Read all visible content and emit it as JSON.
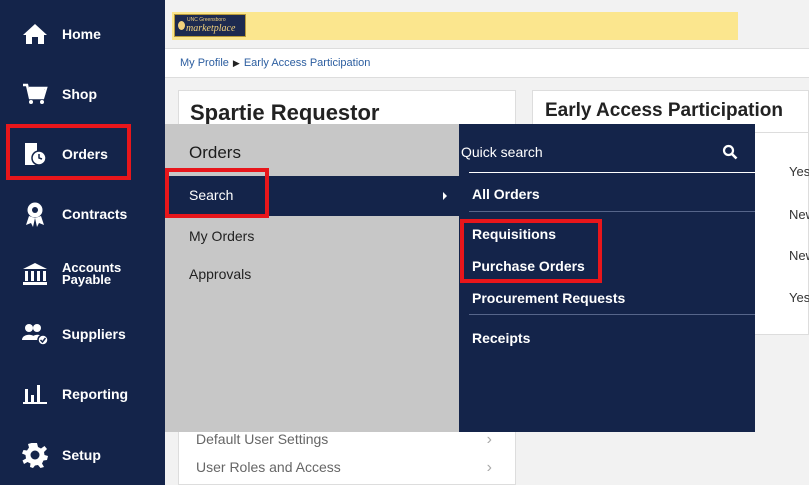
{
  "sidebar": {
    "items": [
      {
        "label": "Home",
        "icon": "home-icon"
      },
      {
        "label": "Shop",
        "icon": "cart-icon"
      },
      {
        "label": "Orders",
        "icon": "orders-icon"
      },
      {
        "label": "Contracts",
        "icon": "contracts-icon"
      },
      {
        "label_line1": "Accounts",
        "label_line2": "Payable",
        "icon": "bank-icon"
      },
      {
        "label": "Suppliers",
        "icon": "suppliers-icon"
      },
      {
        "label": "Reporting",
        "icon": "bar-chart-icon"
      },
      {
        "label": "Setup",
        "icon": "gear-icon"
      }
    ]
  },
  "logo": {
    "small_text": "UNC Greensboro",
    "brand_text": "marketplace"
  },
  "breadcrumb": {
    "item1": "My Profile",
    "item2": "Early Access Participation"
  },
  "profile_card": {
    "title": "Spartie Requestor",
    "rows": [
      "Default User Settings",
      "User Roles and Access"
    ]
  },
  "early_access": {
    "title": "Early Access Participation",
    "values": [
      "Yes",
      "New",
      "New",
      "Yes"
    ]
  },
  "orders_menu": {
    "title": "Orders",
    "items": [
      "Search",
      "My Orders",
      "Approvals"
    ]
  },
  "search_submenu": {
    "quick_search": "Quick search",
    "items": [
      "All Orders",
      "Requisitions",
      "Purchase Orders",
      "Procurement Requests",
      "Receipts"
    ]
  },
  "colors": {
    "sidebar": "#14244a",
    "highlight": "#e8161b",
    "menu_gray": "#c7c7c7",
    "logo_banner": "#fbe68e"
  }
}
